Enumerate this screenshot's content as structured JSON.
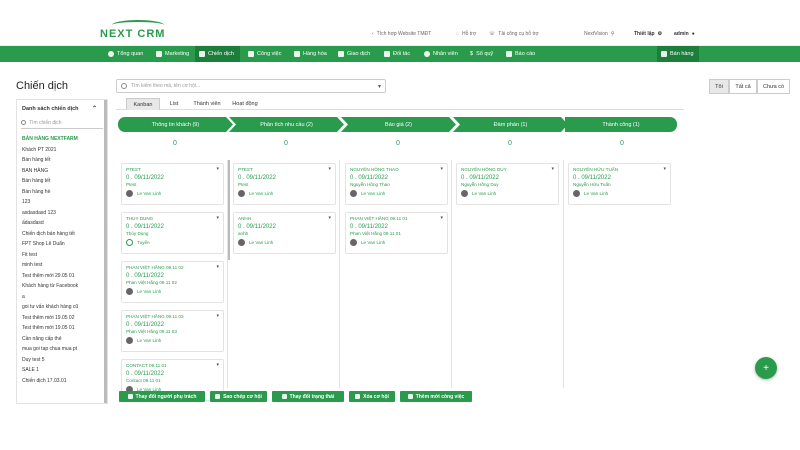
{
  "brand": {
    "logo": "NEXT CRM"
  },
  "topbar": {
    "link1": "Tích hợp Website TMĐT",
    "link2": "Hỗ trợ",
    "link3": "Tải công cụ hỗ trợ",
    "org": "NextVision",
    "settings": "Thiết lập",
    "user": "admin"
  },
  "nav": {
    "items": [
      "Tổng quan",
      "Marketing",
      "Chiến dịch",
      "Công việc",
      "Hàng hóa",
      "Giao dịch",
      "Đối tác",
      "Nhân viên",
      "Sổ quỹ",
      "Báo cáo"
    ],
    "sales": "Bán hàng",
    "active": "Chiến dịch"
  },
  "page": {
    "title": "Chiến dịch",
    "search_placeholder": "Tìm kiếm theo mã, tên cơ hội..."
  },
  "filters": [
    "Tôi",
    "Tất cả",
    "Chưa có"
  ],
  "tabs": [
    "Kanban",
    "List",
    "Thành viên",
    "Hoạt động"
  ],
  "sidebar": {
    "title": "Danh sách chiến dịch",
    "search_placeholder": "Tìm chiến dịch",
    "items": [
      "BÁN HÀNG NEXTFARM",
      "Khách PT 2021",
      "Bán hàng tết",
      "BAN HÀNG",
      "Bán hàng tết",
      "Bán hàng hè",
      "123",
      "asdasdasd 123",
      "ấdasdasd",
      "Chiến dịch bán hàng tết",
      "FPT Shop Lê Duẩn",
      "Fit test",
      "minh test",
      "Test thêm mới 29.05 01",
      "Khách hàng từ Facebook",
      "a",
      "goi tư vấn khách hàng cũ",
      "Test thêm mới 19.05 02",
      "Test thêm mới 19.05 01",
      "Cần nâng cấp thẻ",
      "mua goi tap chua mua pt",
      "Duy test 5",
      "SALE 1",
      "Chiến dịch 17.03.01"
    ]
  },
  "stages": [
    {
      "label": "Thông tin khách (9)",
      "count": "0"
    },
    {
      "label": "Phân tích nhu cầu (2)",
      "count": "0"
    },
    {
      "label": "Báo giá (2)",
      "count": "0"
    },
    {
      "label": "Đàm phán (1)",
      "count": "0"
    },
    {
      "label": "Thành công (1)",
      "count": "0"
    }
  ],
  "cards": [
    [
      {
        "name": "PTEST",
        "value": "0 . 09/11/2022",
        "person": "Ptest",
        "owner": "Le Van Linh",
        "avatar": "photo"
      },
      {
        "name": "THỦY DUNG",
        "value": "0 . 09/11/2022",
        "person": "Thủy Dung",
        "owner": "Tuyển",
        "avatar": "green"
      },
      {
        "name": "PHAN VIỆT HẰNG 09.11 02",
        "value": "0 . 09/11/2022",
        "person": "Phan Việt Hằng 09.11 02",
        "owner": "Le Van Linh",
        "avatar": "photo"
      },
      {
        "name": "PHAN VIỆT HẰNG 09.11 03",
        "value": "0 . 09/11/2022",
        "person": "Phan Việt Hằng 09.11 03",
        "owner": "Le Van Linh",
        "avatar": "photo"
      },
      {
        "name": "CONTACT 09.11 01",
        "value": "0 . 09/11/2022",
        "person": "Contact 09.11 01",
        "owner": "Le Van Linh",
        "avatar": "photo"
      }
    ],
    [
      {
        "name": "PTEST",
        "value": "0 . 09/11/2022",
        "person": "Ptest",
        "owner": "Le Van Linh",
        "avatar": "photo"
      },
      {
        "name": "ANHH",
        "value": "0 . 09/11/2022",
        "person": "anhh",
        "owner": "Le Van Linh",
        "avatar": "photo"
      }
    ],
    [
      {
        "name": "NGUYỄN HỒNG THAO",
        "value": "0 . 09/11/2022",
        "person": "Nguyễn Hồng Thao",
        "owner": "Le Van Linh",
        "avatar": "photo"
      },
      {
        "name": "PHAN VIỆT HẰNG 09.11 01",
        "value": "0 . 09/11/2022",
        "person": "Phan Việt Hằng 09.11 01",
        "owner": "Le Van Linh",
        "avatar": "photo"
      }
    ],
    [
      {
        "name": "NGUYỄN HỒNG DUY",
        "value": "0 . 09/11/2022",
        "person": "Nguyễn Hồng Duy",
        "owner": "Le Van Linh",
        "avatar": "photo"
      }
    ],
    [
      {
        "name": "NGUYỄN HỮU TUẤN",
        "value": "0 . 09/11/2022",
        "person": "Nguyễn Hữu Tuấn",
        "owner": "Le Van Linh",
        "avatar": "photo"
      }
    ]
  ],
  "actions": [
    "Thay đổi người phụ trách",
    "Sao chép cơ hội",
    "Thay đổi trạng thái",
    "Xóa cơ hội",
    "Thêm mới công việc"
  ],
  "fab": "+",
  "colors": {
    "accent": "#2a9b4d",
    "accent_dark": "#1d7d3b"
  }
}
